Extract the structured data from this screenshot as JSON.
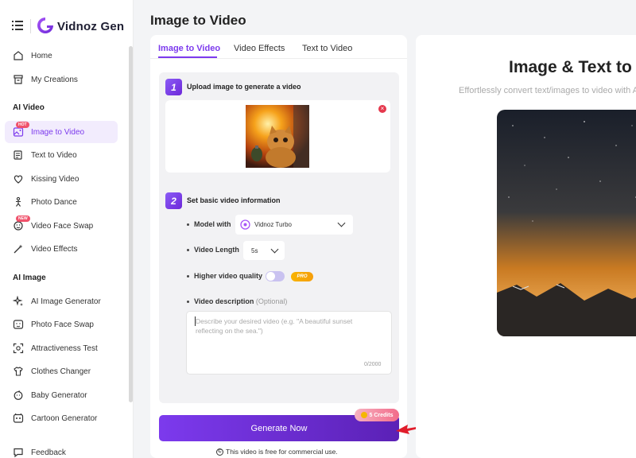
{
  "app": {
    "name": "Vidnoz Gen"
  },
  "sidebar": {
    "items_top": [
      {
        "label": "Home",
        "icon": "home-icon"
      },
      {
        "label": "My Creations",
        "icon": "archive-icon"
      }
    ],
    "section_video": "AI Video",
    "video_items": [
      {
        "label": "Image to Video",
        "icon": "image-video-icon",
        "badge": "HOT",
        "active": true
      },
      {
        "label": "Text to Video",
        "icon": "text-video-icon"
      },
      {
        "label": "Kissing Video",
        "icon": "kiss-icon"
      },
      {
        "label": "Photo Dance",
        "icon": "dance-icon"
      },
      {
        "label": "Video Face Swap",
        "icon": "face-swap-icon",
        "badge": "NEW"
      },
      {
        "label": "Video Effects",
        "icon": "magic-wand-icon"
      }
    ],
    "section_image": "AI Image",
    "image_items": [
      {
        "label": "AI Image Generator",
        "icon": "sparkle-icon"
      },
      {
        "label": "Photo Face Swap",
        "icon": "photo-swap-icon"
      },
      {
        "label": "Attractiveness Test",
        "icon": "scan-icon"
      },
      {
        "label": "Clothes Changer",
        "icon": "shirt-icon"
      },
      {
        "label": "Baby Generator",
        "icon": "baby-icon"
      },
      {
        "label": "Cartoon Generator",
        "icon": "cartoon-icon"
      }
    ],
    "feedback": "Feedback"
  },
  "page": {
    "title": "Image to Video"
  },
  "tabs": [
    "Image to Video",
    "Video Effects",
    "Text to Video"
  ],
  "step1": {
    "number": "1",
    "title": "Upload image to generate a video"
  },
  "step2": {
    "number": "2",
    "title": "Set basic video information",
    "model_label": "Model with",
    "model_value": "Vidnoz Turbo",
    "length_label": "Video Length",
    "length_value": "5s",
    "quality_label": "Higher video quality",
    "quality_on": false,
    "pro_badge": "PRO",
    "desc_label": "Video description",
    "desc_optional": "(Optional)",
    "desc_placeholder": "Describe your desired video (e.g. \"A beautiful sunset reflecting on the sea.\")",
    "desc_count": "0/2000"
  },
  "generate": {
    "label": "Generate Now",
    "credits": "5 Credits"
  },
  "commercial_note": "This video is free for commercial use.",
  "hero": {
    "title": "Image & Text to V",
    "subtitle": "Effortlessly convert text/images to video with A"
  },
  "colors": {
    "accent": "#7c3aed",
    "hot": "#f0526b",
    "pro": "#f59e0b"
  }
}
